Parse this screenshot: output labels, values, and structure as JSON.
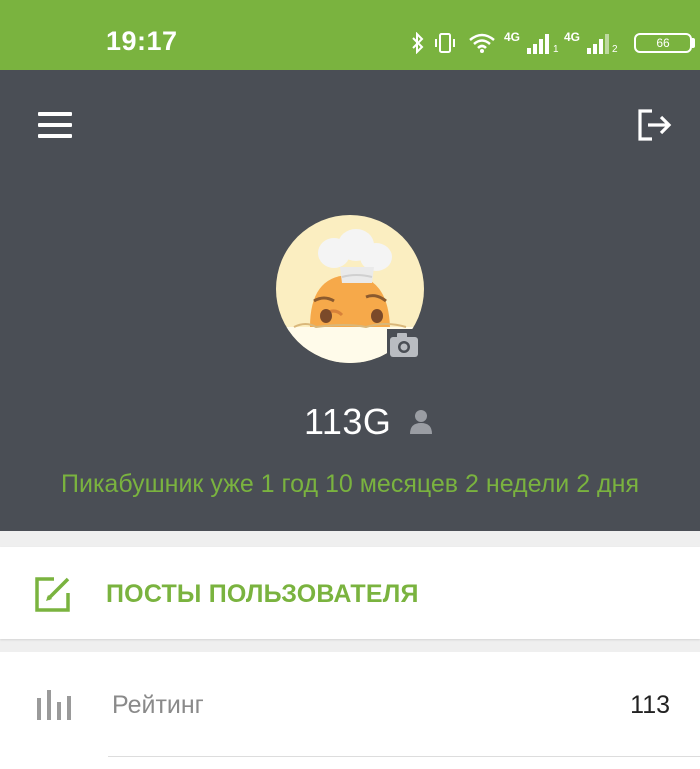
{
  "statusbar": {
    "time": "19:17",
    "network1": "4G",
    "sim1": "1",
    "network2": "4G",
    "sim2": "2",
    "battery": "66",
    "icons": [
      "bluetooth-icon",
      "vibrate-icon",
      "wifi-icon",
      "signal-icon",
      "signal-icon",
      "battery-icon"
    ]
  },
  "header": {
    "menu_icon": "menu-icon",
    "logout_icon": "logout-icon",
    "background": "#4a4e55"
  },
  "profile": {
    "username": "113G",
    "membership": "Пикабушник уже 1 год 10 месяцев 2 недели 2 дня",
    "avatar_icon": "chef-avatar",
    "camera_icon": "camera-icon",
    "user_icon": "user-icon"
  },
  "posts": {
    "label": "ПОСТЫ ПОЛЬЗОВАТЕЛЯ",
    "icon": "edit-icon"
  },
  "stats": {
    "rating_label": "Рейтинг",
    "rating_value": "113",
    "rating_icon": "bar-chart-icon"
  },
  "colors": {
    "accent": "#7ab33f",
    "header_bg": "#4a4e55",
    "text_dark": "#222222",
    "text_muted": "#8a8a8a"
  }
}
